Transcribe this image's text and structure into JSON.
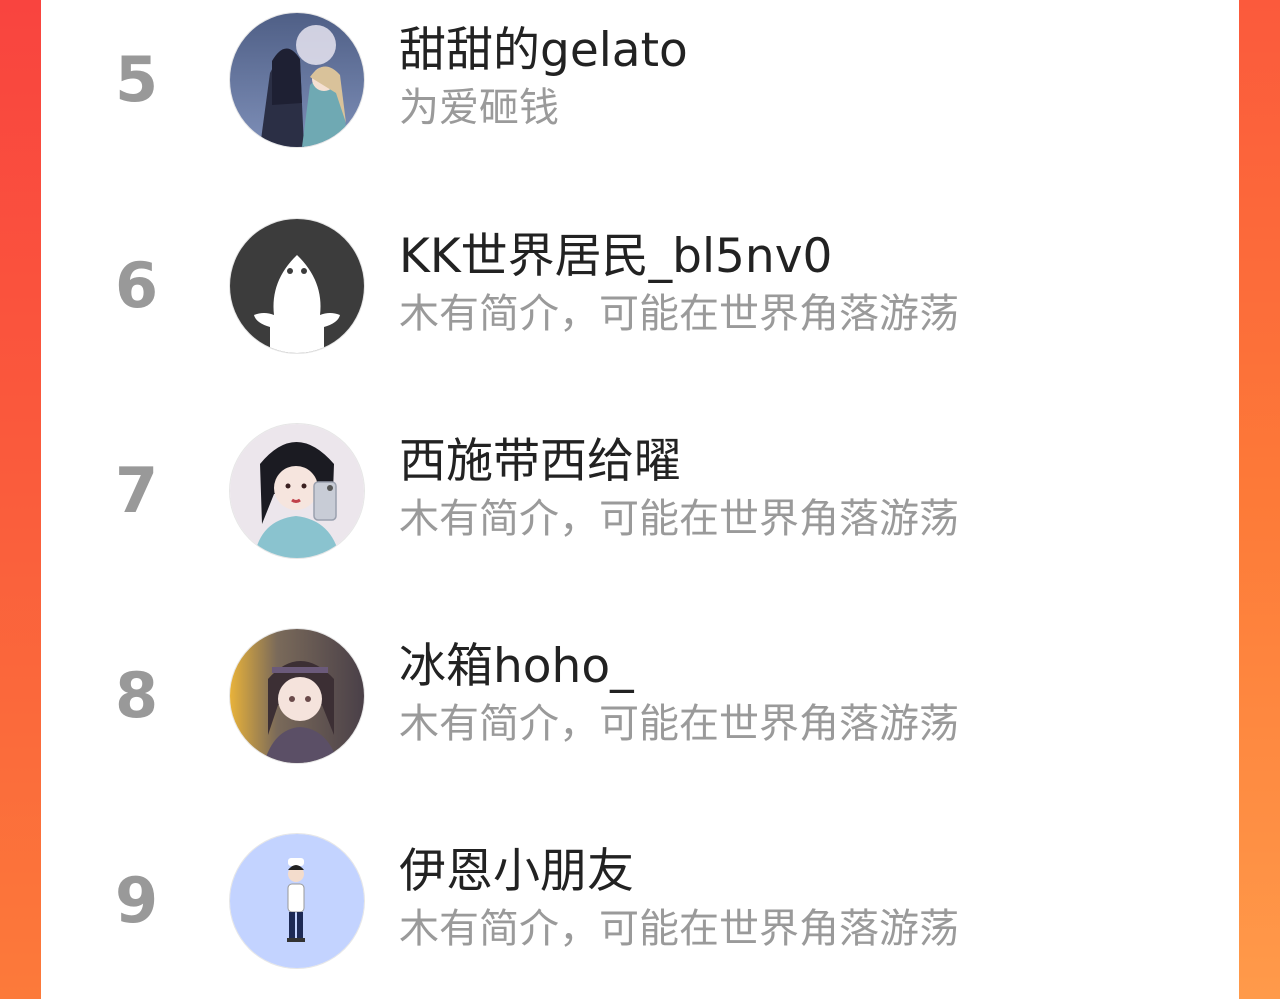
{
  "ranking": {
    "items": [
      {
        "rank": "5",
        "name": "甜甜的gelato",
        "bio": "为爱砸钱",
        "avatar": "couple-illustration-avatar"
      },
      {
        "rank": "6",
        "name": "KK世界居民_bl5nv0",
        "bio": "木有简介，可能在世界角落游荡",
        "avatar": "default-ghost-avatar"
      },
      {
        "rank": "7",
        "name": "西施带西给曜",
        "bio": "木有简介，可能在世界角落游荡",
        "avatar": "girl-selfie-avatar"
      },
      {
        "rank": "8",
        "name": "冰箱hoho_",
        "bio": "木有简介，可能在世界角落游荡",
        "avatar": "anime-character-avatar"
      },
      {
        "rank": "9",
        "name": "伊恩小朋友",
        "bio": "木有简介，可能在世界角落游荡",
        "avatar": "cartoon-boy-avatar"
      }
    ]
  },
  "colors": {
    "background_accent": "#fa5a3c",
    "rank_text": "#999999",
    "name_text": "#222222",
    "bio_text": "#9a9a9a",
    "panel": "#ffffff"
  }
}
